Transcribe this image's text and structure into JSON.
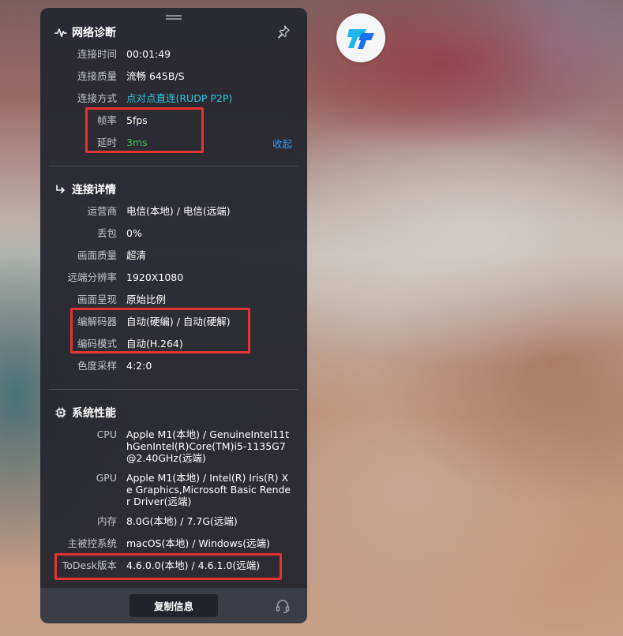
{
  "network": {
    "title": "网络诊断",
    "rows": [
      {
        "label": "连接时间",
        "value": "00:01:49"
      },
      {
        "label": "连接质量",
        "value": "流畅 645B/S"
      },
      {
        "label": "连接方式",
        "value": "点对点直连(RUDP P2P)"
      },
      {
        "label": "帧率",
        "value": "5fps"
      },
      {
        "label": "延时",
        "value": "3ms"
      }
    ],
    "collapse_label": "收起"
  },
  "details": {
    "title": "连接详情",
    "rows": [
      {
        "label": "运营商",
        "value": "电信(本地) / 电信(远端)"
      },
      {
        "label": "丢包",
        "value": "0%"
      },
      {
        "label": "画面质量",
        "value": "超清"
      },
      {
        "label": "远端分辨率",
        "value": "1920X1080"
      },
      {
        "label": "画面呈现",
        "value": "原始比例"
      },
      {
        "label": "编解码器",
        "value": "自动(硬编) / 自动(硬解)"
      },
      {
        "label": "编码模式",
        "value": "自动(H.264)"
      },
      {
        "label": "色度采样",
        "value": "4:2:0"
      }
    ]
  },
  "system": {
    "title": "系统性能",
    "rows": [
      {
        "label": "CPU",
        "value": "Apple M1(本地) / GenuineIntel11thGenIntel(R)Core(TM)i5-1135G7 @2.40GHz(远端)"
      },
      {
        "label": "GPU",
        "value": "Apple M1(本地) / Intel(R) Iris(R) Xe Graphics,Microsoft Basic Render Driver(远端)"
      },
      {
        "label": "内存",
        "value": "8.0G(本地) / 7.7G(远端)"
      },
      {
        "label": "主被控系统",
        "value": "macOS(本地) / Windows(远端)"
      },
      {
        "label": "ToDesk版本",
        "value": "4.6.0.0(本地) / 4.6.1.0(远端)"
      }
    ]
  },
  "footer": {
    "copy_label": "复制信息"
  },
  "colors": {
    "accent_link": "#2a9cf2",
    "cyan_value": "#2ec8de",
    "green_value": "#35c84e",
    "highlight": "#e53232"
  },
  "icons": [
    "pulse-icon",
    "pin-icon",
    "arrow-turn-icon",
    "chip-icon",
    "headset-icon",
    "todesk-logo-icon"
  ]
}
